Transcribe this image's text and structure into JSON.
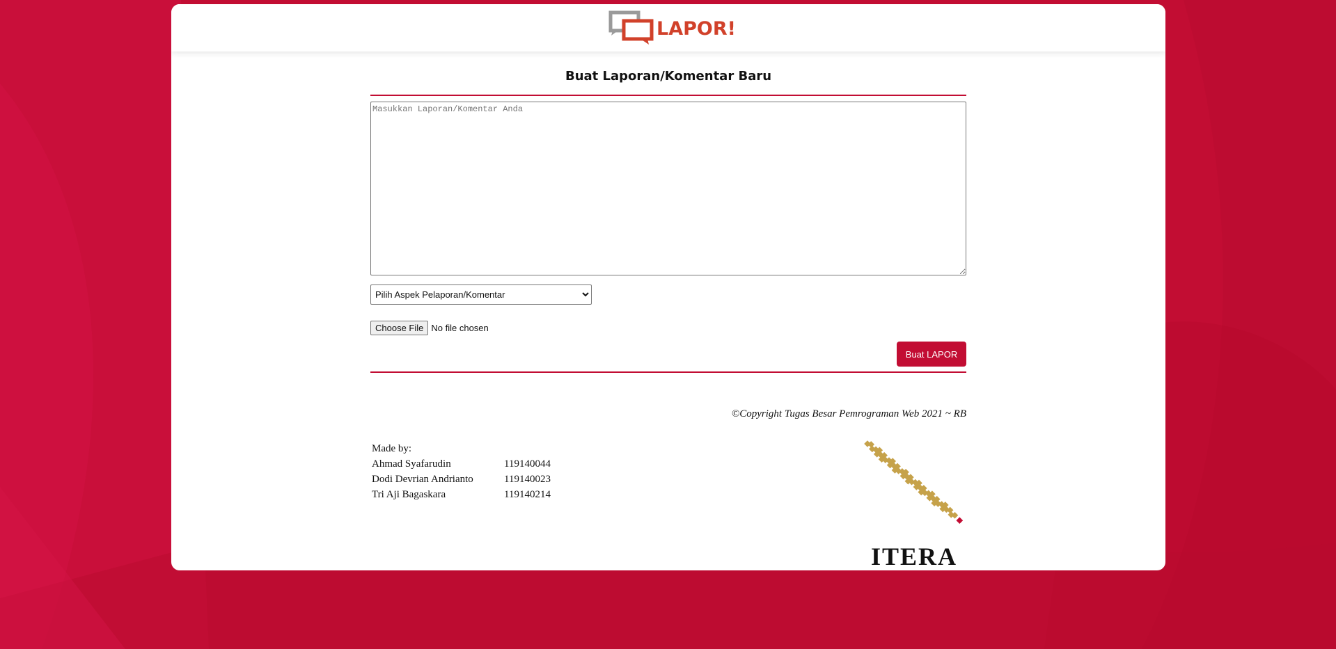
{
  "header": {
    "logo_text": "LAPOR!"
  },
  "form": {
    "title": "Buat Laporan/Komentar Baru",
    "textarea_placeholder": "Masukkan Laporan/Komentar Anda",
    "aspect_select": {
      "selected": "Pilih Aspek Pelaporan/Komentar",
      "options": [
        "Pilih Aspek Pelaporan/Komentar"
      ]
    },
    "file_button_label": "Choose File",
    "file_status": "No file chosen",
    "submit_label": "Buat LAPOR"
  },
  "footer": {
    "copyright": "©Copyright Tugas Besar Pemrograman Web 2021 ~ RB",
    "made_by_label": "Made by:",
    "authors": [
      {
        "name": "Ahmad Syafarudin",
        "id": "119140044"
      },
      {
        "name": "Dodi Devrian Andrianto",
        "id": "119140023"
      },
      {
        "name": "Tri Aji Bagaskara",
        "id": "119140214"
      }
    ],
    "itera_logo_text": "ITERA"
  },
  "colors": {
    "brand_red": "#c20d33",
    "logo_red": "#d1412a",
    "logo_grey": "#9a9a9a",
    "itera_gold": "#c6a24a"
  },
  "icons": {
    "logo": "chat-bubbles-icon",
    "itera": "itera-map-logo"
  }
}
